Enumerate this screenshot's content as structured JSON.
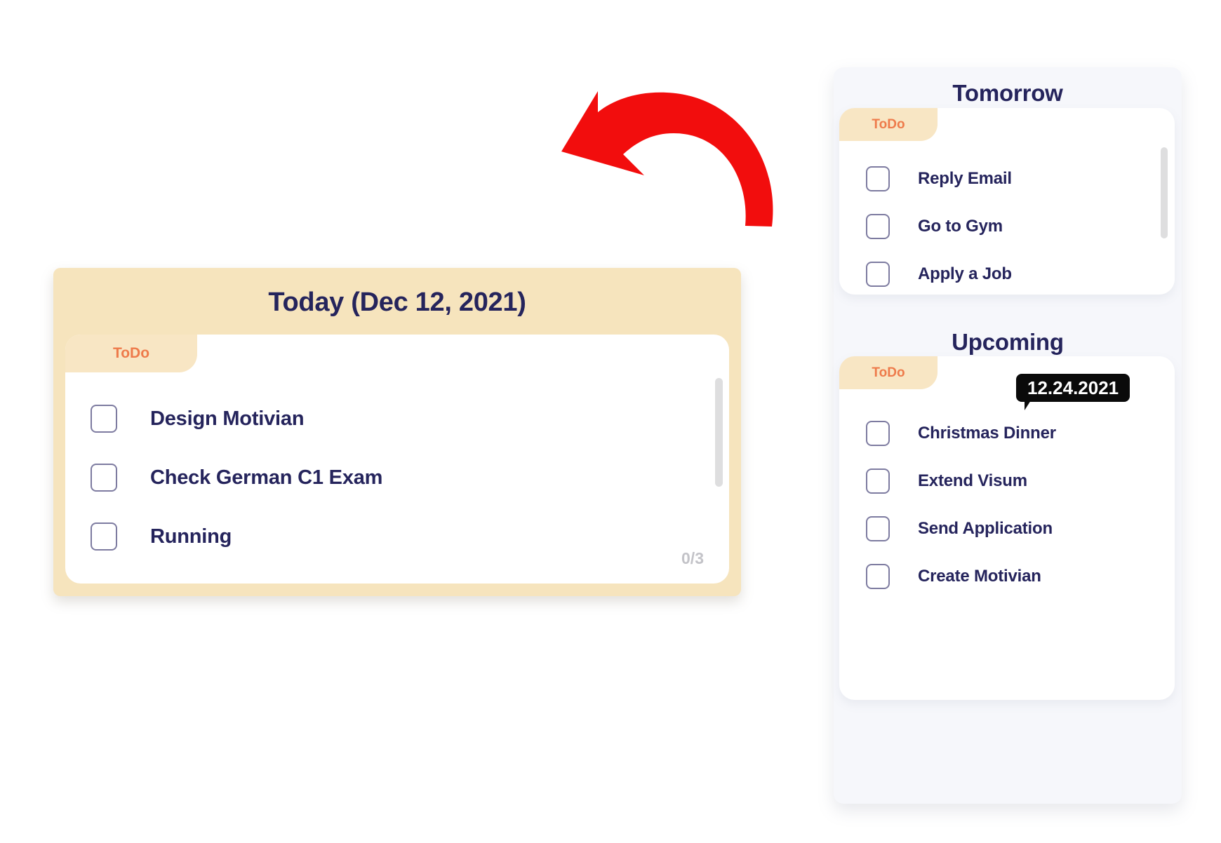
{
  "colors": {
    "beige_card": "#f6e4bd",
    "tab_beige": "#f8e6c4",
    "tab_label_orange": "#ee7b4b",
    "navy_text": "#25245c",
    "panel_bg": "#f6f7fb",
    "badge_black": "#0a0a0a",
    "counter_gray": "#c3c3c8",
    "checkbox_border": "#7d7ba0",
    "arrow_red": "#f20d0d",
    "scrollbar": "#dededf"
  },
  "annotation": {
    "arrow_icon": "curved-arrow-down-left"
  },
  "today": {
    "title": "Today (Dec 12, 2021)",
    "tab_label": "ToDo",
    "counter": "0/3",
    "tasks": [
      {
        "label": "Design Motivian",
        "checked": false
      },
      {
        "label": "Check German C1 Exam",
        "checked": false
      },
      {
        "label": "Running",
        "checked": false
      }
    ]
  },
  "tomorrow": {
    "heading": "Tomorrow",
    "tab_label": "ToDo",
    "tasks": [
      {
        "label": "Reply Email",
        "checked": false
      },
      {
        "label": "Go to Gym",
        "checked": false
      },
      {
        "label": "Apply a Job",
        "checked": false
      }
    ]
  },
  "upcoming": {
    "heading": "Upcoming",
    "tab_label": "ToDo",
    "date_badge": "12.24.2021",
    "tasks": [
      {
        "label": "Christmas Dinner",
        "checked": false
      },
      {
        "label": "Extend Visum",
        "checked": false
      },
      {
        "label": "Send Application",
        "checked": false
      },
      {
        "label": "Create Motivian",
        "checked": false
      }
    ]
  }
}
